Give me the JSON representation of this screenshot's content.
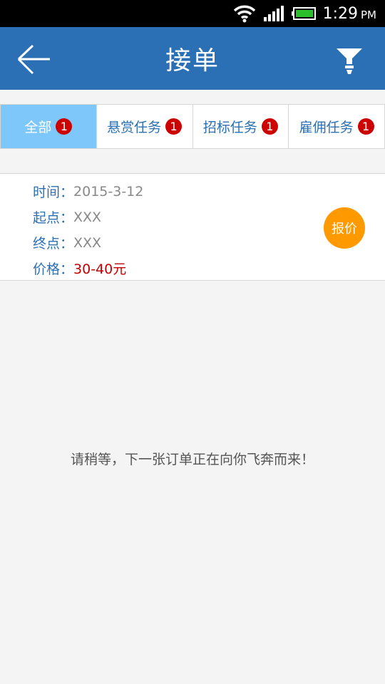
{
  "status_bar": {
    "time": "1:29",
    "ampm": "PM",
    "icons": [
      "wifi-icon",
      "signal-icon",
      "battery-icon"
    ],
    "battery_color": "#2bc02b"
  },
  "header": {
    "title": "接单",
    "back_icon": "back-arrow-icon",
    "filter_icon": "filter-icon",
    "background": "#2b70b4"
  },
  "tabs": [
    {
      "label": "全部",
      "badge": "1",
      "active": true
    },
    {
      "label": "悬赏任务",
      "badge": "1",
      "active": false
    },
    {
      "label": "招标任务",
      "badge": "1",
      "active": false
    },
    {
      "label": "雇佣任务",
      "badge": "1",
      "active": false
    }
  ],
  "order": {
    "time_label": "时间：",
    "time_value": "2015-3-12",
    "start_label": "起点：",
    "start_value": "XXX",
    "end_label": "终点：",
    "end_value": "XXX",
    "price_label": "价格：",
    "price_value": "30-40元",
    "quote_button": "报价"
  },
  "waiting_message": "请稍等，下一张订单正在向你飞奔而来！"
}
